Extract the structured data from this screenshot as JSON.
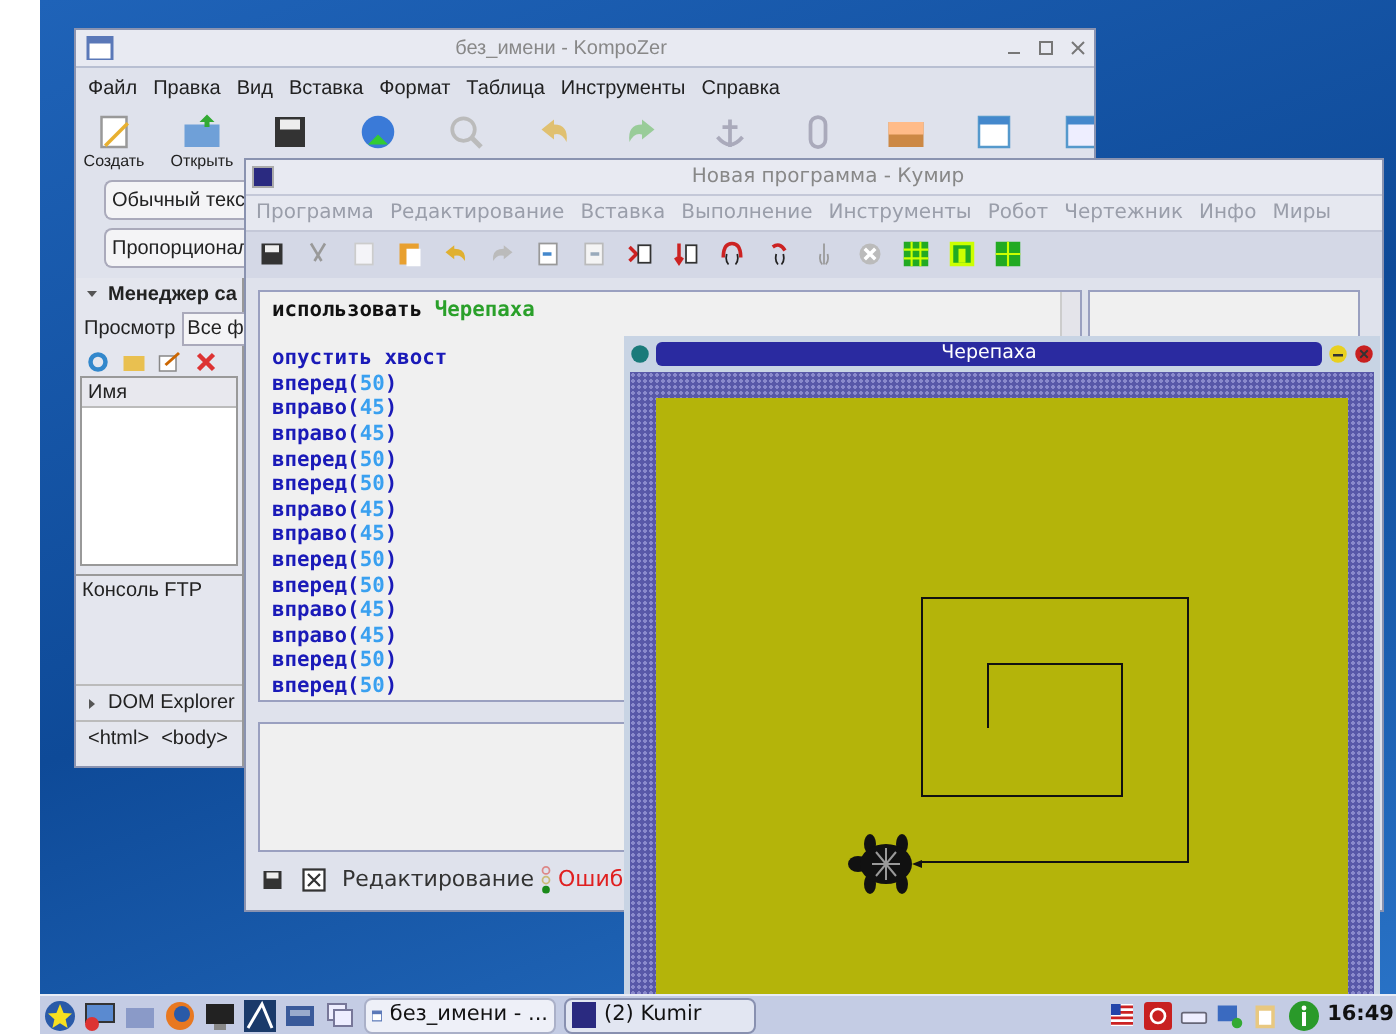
{
  "kompozer": {
    "title": "без_имени - KompoZer",
    "menu": [
      "Файл",
      "Правка",
      "Вид",
      "Вставка",
      "Формат",
      "Таблица",
      "Инструменты",
      "Справка"
    ],
    "toolbar": [
      {
        "kind": "new",
        "label": "Создать"
      },
      {
        "kind": "open",
        "label": "Открыть"
      },
      {
        "kind": "save"
      },
      {
        "kind": "globe"
      },
      {
        "kind": "search"
      },
      {
        "kind": "undo"
      },
      {
        "kind": "redo"
      },
      {
        "kind": "anchor"
      },
      {
        "kind": "link"
      },
      {
        "kind": "image"
      },
      {
        "kind": "table"
      },
      {
        "kind": "form"
      }
    ],
    "paragraph_format": "Обычный текс",
    "font": "Пропорционал",
    "site_manager": {
      "title": "Менеджер са",
      "tabs": [
        {
          "label": "Просмотр",
          "selected": true
        }
      ],
      "filter": "Все ф",
      "column": "Имя"
    },
    "ftp_console": "Консоль FTP",
    "dom_explorer": "DOM Explorer",
    "breadcrumbs": [
      "<html>",
      "<body>"
    ]
  },
  "kumir": {
    "title": "Новая программа - Кумир",
    "menu": [
      "Программа",
      "Редактирование",
      "Вставка",
      "Выполнение",
      "Инструменты",
      "Робот",
      "Чертежник",
      "Инфо",
      "Миры"
    ],
    "code": [
      {
        "kind": "use",
        "keyword": "использовать",
        "name": "Черепаха"
      },
      {
        "kind": "blank"
      },
      {
        "kind": "cmd",
        "name": "опустить хвост"
      },
      {
        "kind": "call",
        "name": "вперед",
        "open": "(",
        "arg": "50",
        "close": ")"
      },
      {
        "kind": "call",
        "name": "вправо",
        "open": "(",
        "arg": "45",
        "close": ")"
      },
      {
        "kind": "call",
        "name": "вправо",
        "open": "(",
        "arg": "45",
        "close": ")"
      },
      {
        "kind": "call",
        "name": "вперед",
        "open": "(",
        "arg": "50",
        "close": ")"
      },
      {
        "kind": "call",
        "name": "вперед",
        "open": "(",
        "arg": "50",
        "close": ")"
      },
      {
        "kind": "call",
        "name": "вправо",
        "open": "(",
        "arg": "45",
        "close": ")"
      },
      {
        "kind": "call",
        "name": "вправо",
        "open": "(",
        "arg": "45",
        "close": ")"
      },
      {
        "kind": "call",
        "name": "вперед",
        "open": "(",
        "arg": "50",
        "close": ")"
      },
      {
        "kind": "call",
        "name": "вперед",
        "open": "(",
        "arg": "50",
        "close": ")"
      },
      {
        "kind": "call",
        "name": "вправо",
        "open": "(",
        "arg": "45",
        "close": ")"
      },
      {
        "kind": "call",
        "name": "вправо",
        "open": "(",
        "arg": "45",
        "close": ")"
      },
      {
        "kind": "call",
        "name": "вперед",
        "open": "(",
        "arg": "50",
        "close": ")"
      },
      {
        "kind": "call",
        "name": "вперед",
        "open": "(",
        "arg": "50",
        "close": ")"
      }
    ],
    "status": {
      "mode": "Редактирование",
      "errors": "Ошиб"
    }
  },
  "turtle_window": {
    "title": "Черепаха"
  },
  "taskbar": {
    "tasks": [
      {
        "label": "без_имени - ...",
        "kind": "kompozer",
        "selected": false
      },
      {
        "label": "(2) Kumir",
        "kind": "kumir",
        "selected": true
      }
    ],
    "clock": "16:49"
  }
}
